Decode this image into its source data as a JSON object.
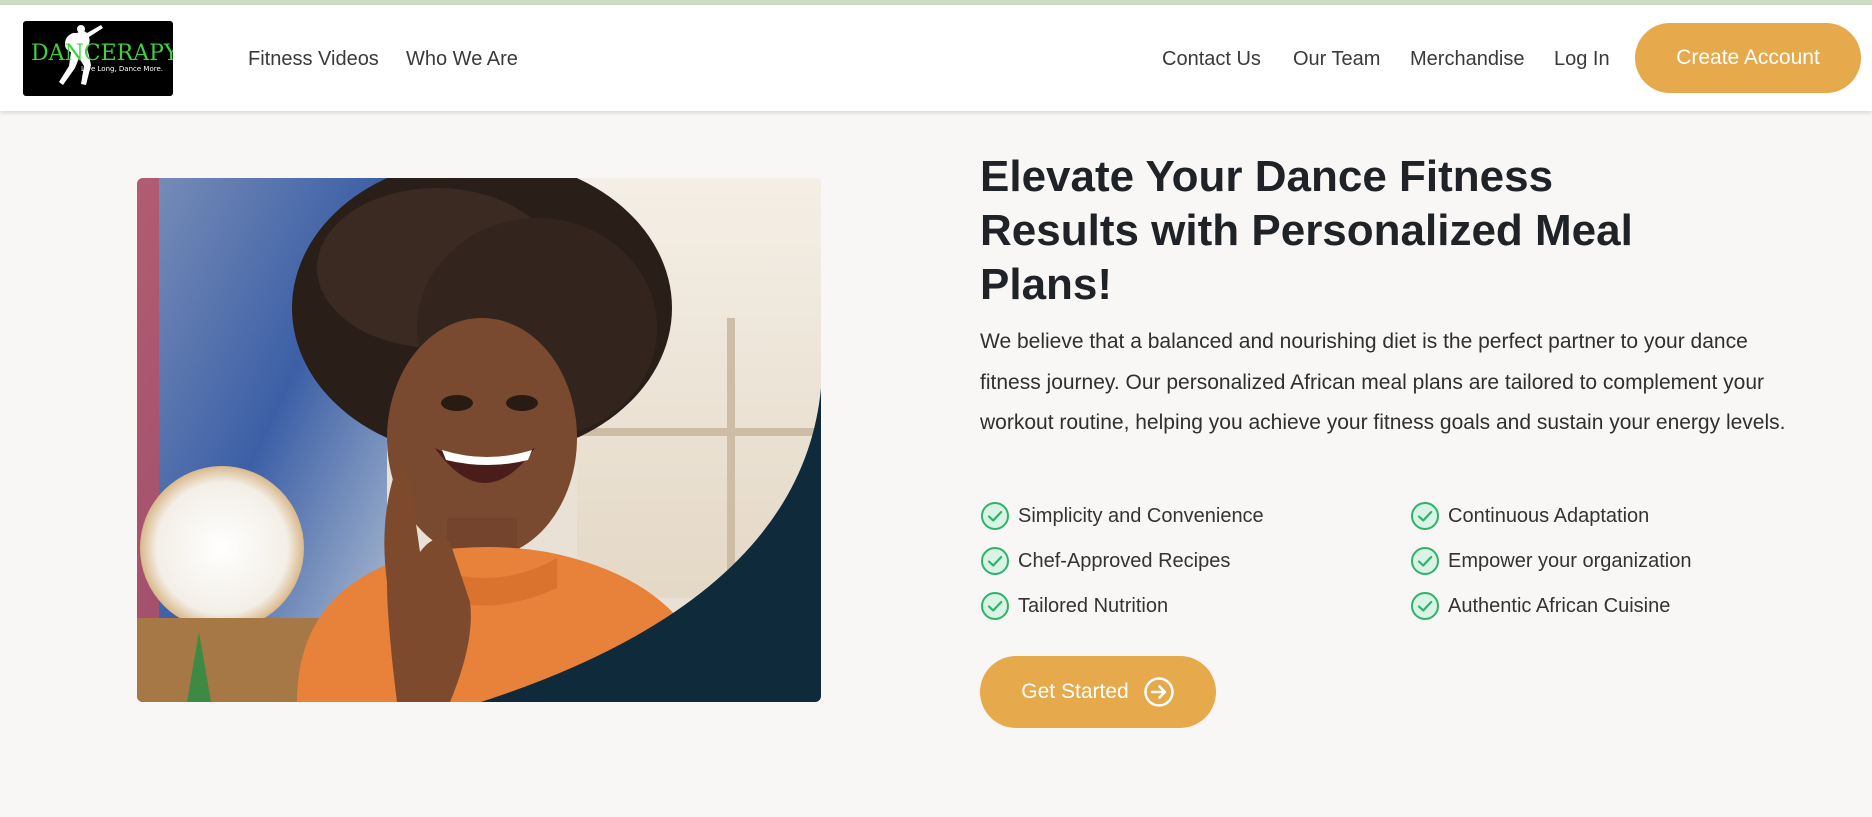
{
  "brand": {
    "logo_text": "DANCERAPY",
    "tagline": "Live Long, Dance More."
  },
  "nav": {
    "left": [
      "Fitness Videos",
      "Who We Are"
    ],
    "right": [
      "Contact Us",
      "Our Team",
      "Merchandise",
      "Log In"
    ],
    "cta": "Create Account"
  },
  "hero": {
    "headline": "Elevate Your Dance Fitness Results with Personalized Meal Plans!",
    "description": "We believe that a balanced and nourishing diet is the perfect partner to your dance fitness journey. Our personalized African meal plans are tailored to complement your workout routine, helping you achieve your fitness goals and sustain your energy levels.",
    "features": [
      "Simplicity and Convenience",
      "Chef-Approved Recipes",
      "Tailored Nutrition",
      "Continuous Adaptation",
      "Empower your organization",
      "Authentic African Cuisine"
    ],
    "cta": "Get Started"
  },
  "colors": {
    "accent": "#e6a94b",
    "check": "#2fb36a",
    "dark_curve": "#0e2a3b",
    "heading": "#1f2226"
  },
  "icons": {
    "feature": "check-circle-icon",
    "cta": "arrow-right-circle-icon"
  }
}
